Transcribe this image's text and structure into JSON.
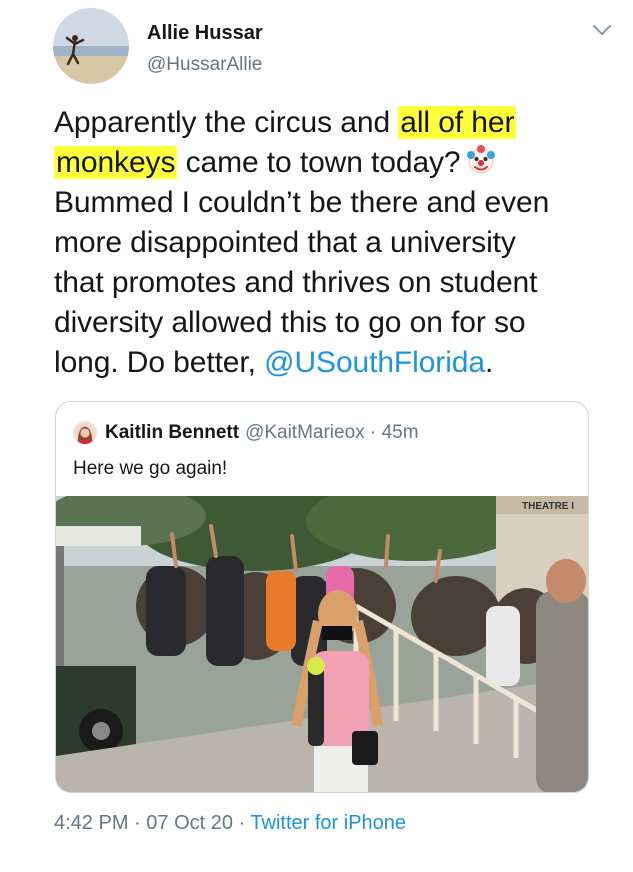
{
  "tweet": {
    "author_name": "Allie Hussar",
    "author_handle": "@HussarAllie",
    "text": {
      "l1_a": "Apparently the circus and ",
      "l1_hl": "all of her",
      "l2_hl": "monkeys",
      "l2_b": " came to town today?",
      "l3": "Bummed I couldn’t be there and even",
      "l4": "more disappointed that a university",
      "l5": "that promotes and thrives on student",
      "l6": "diversity allowed this to go on for so",
      "l7_a": "long. Do better, ",
      "mention": "@USouthFlorida",
      "l7_b": "."
    },
    "emoji": "clown-face-icon",
    "highlight_color": "#ffff3a"
  },
  "quoted_tweet": {
    "author_name": "Kaitlin Bennett",
    "author_handle": "@KaitMarieox",
    "separator": " · ",
    "time": "45m",
    "text": "Here we go again!",
    "photo_sign": "THEATRE I"
  },
  "footer": {
    "time": "4:42 PM",
    "separator": " · ",
    "date": "07 Oct 20",
    "source": "Twitter for iPhone"
  },
  "colors": {
    "link": "#1b95e0",
    "secondary_text": "#657786",
    "border": "#ccd6dd"
  }
}
